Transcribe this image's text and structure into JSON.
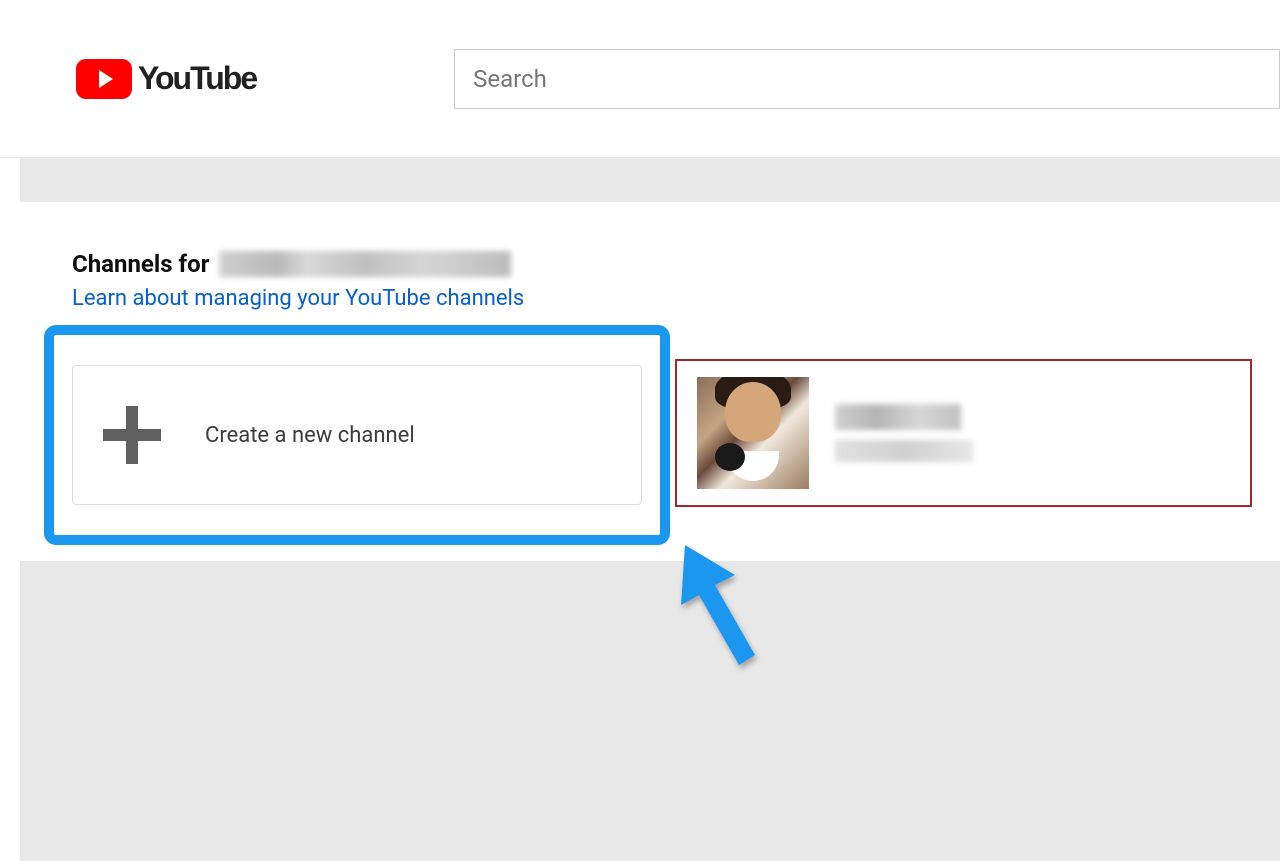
{
  "brand": {
    "name": "YouTube"
  },
  "search": {
    "placeholder": "Search"
  },
  "page": {
    "heading_prefix": "Channels for",
    "learn_link": "Learn about managing your YouTube channels"
  },
  "cards": {
    "create_label": "Create a new channel"
  },
  "colors": {
    "highlight": "#1a97ef",
    "channel_border": "#a12828",
    "youtube_red": "#ff0000",
    "link_blue": "#065fd4"
  }
}
